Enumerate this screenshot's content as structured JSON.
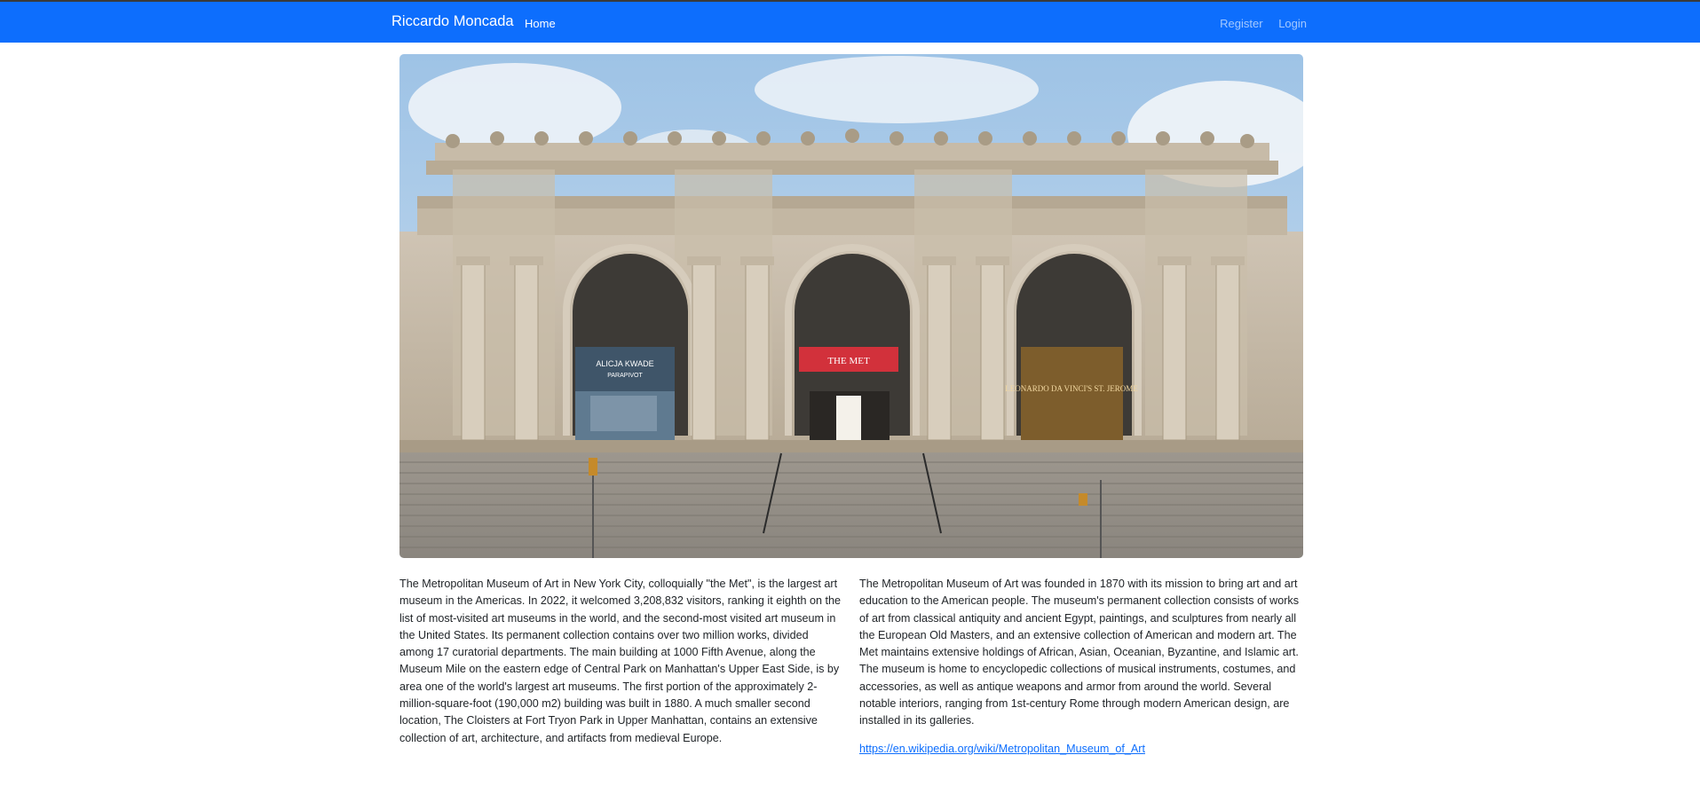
{
  "navbar": {
    "brand": "Riccardo Moncada",
    "home_label": "Home",
    "register_label": "Register",
    "login_label": "Login",
    "bg_color": "#0d6efd"
  },
  "hero": {
    "banner_left_title": "ALICJA KWADE",
    "banner_left_subtitle": "PARAPIVOT",
    "banner_center_text": "THE MET",
    "banner_right_title": "LEONARDO DA VINCI'S ST. JEROME"
  },
  "content": {
    "paragraph_left": "The Metropolitan Museum of Art in New York City, colloquially \"the Met\", is the largest art museum in the Americas. In 2022, it welcomed 3,208,832 visitors, ranking it eighth on the list of most-visited art museums in the world, and the second-most visited art museum in the United States. Its permanent collection contains over two million works, divided among 17 curatorial departments. The main building at 1000 Fifth Avenue, along the Museum Mile on the eastern edge of Central Park on Manhattan's Upper East Side, is by area one of the world's largest art museums. The first portion of the approximately 2-million-square-foot (190,000 m2) building was built in 1880. A much smaller second location, The Cloisters at Fort Tryon Park in Upper Manhattan, contains an extensive collection of art, architecture, and artifacts from medieval Europe.",
    "paragraph_right": "The Metropolitan Museum of Art was founded in 1870 with its mission to bring art and art education to the American people. The museum's permanent collection consists of works of art from classical antiquity and ancient Egypt, paintings, and sculptures from nearly all the European Old Masters, and an extensive collection of American and modern art. The Met maintains extensive holdings of African, Asian, Oceanian, Byzantine, and Islamic art. The museum is home to encyclopedic collections of musical instruments, costumes, and accessories, as well as antique weapons and armor from around the world. Several notable interiors, ranging from 1st-century Rome through modern American design, are installed in its galleries.",
    "link_text": "https://en.wikipedia.org/wiki/Metropolitan_Museum_of_Art",
    "link_color": "#0d6efd"
  }
}
